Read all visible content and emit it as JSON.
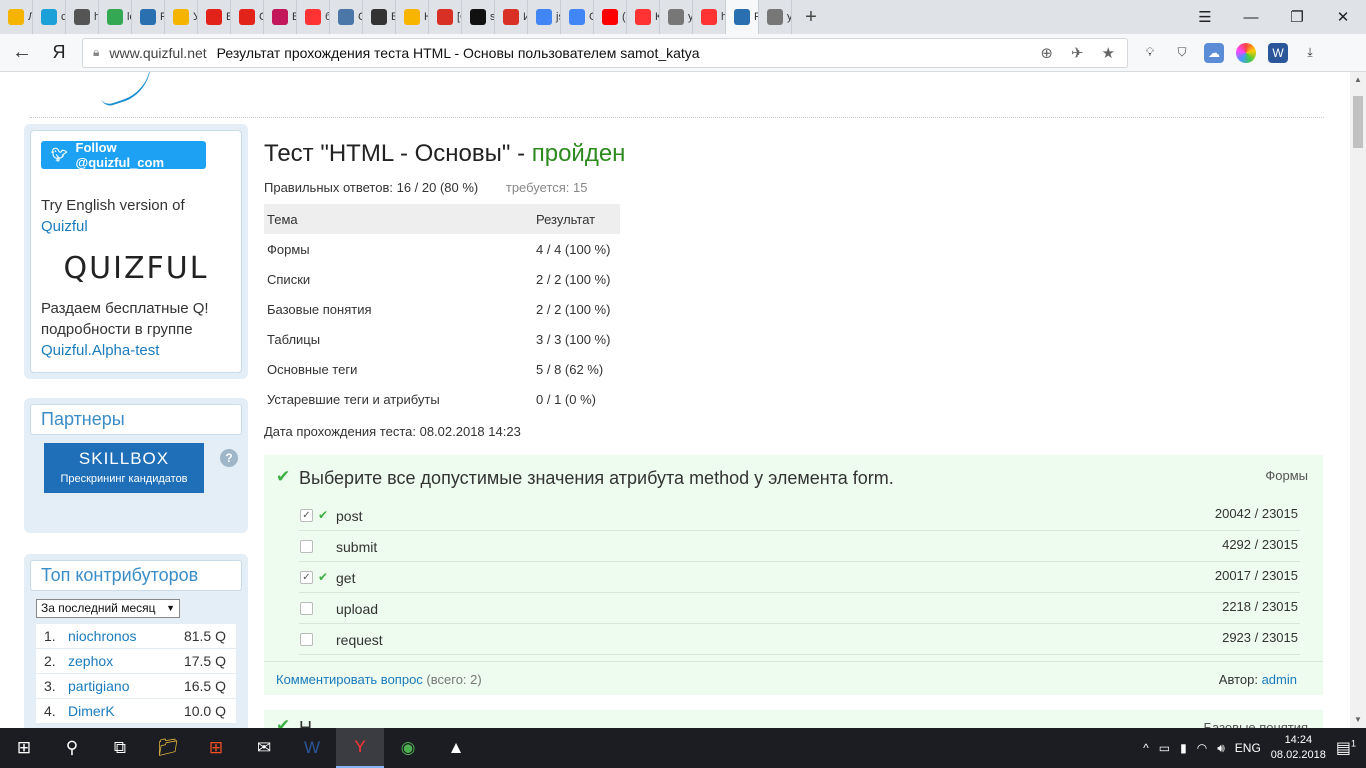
{
  "browser": {
    "tabs": [
      {
        "label": "Л",
        "icon": "lightbulb-icon",
        "color": "#f5b400"
      },
      {
        "label": "cisco",
        "icon": "cisco-icon",
        "color": "#1ba0d7"
      },
      {
        "label": "h",
        "icon": "shield-icon",
        "color": "#555555"
      },
      {
        "label": "le",
        "icon": "drive-icon",
        "color": "#34a853"
      },
      {
        "label": "Р",
        "icon": "quizful-icon",
        "color": "#2a6fb0"
      },
      {
        "label": "У",
        "icon": "lightbulb-icon",
        "color": "#f5b400"
      },
      {
        "label": "В",
        "icon": "figure-icon",
        "color": "#e2231a"
      },
      {
        "label": "С",
        "icon": "figure-icon",
        "color": "#e2231a"
      },
      {
        "label": "В",
        "icon": "video-icon",
        "color": "#c2185b"
      },
      {
        "label": "б",
        "icon": "yandex-icon",
        "color": "#ff3333"
      },
      {
        "label": "С",
        "icon": "doc-icon",
        "color": "#4a76a8"
      },
      {
        "label": "Б",
        "icon": "clapper-icon",
        "color": "#333333"
      },
      {
        "label": "Н",
        "icon": "ph-icon",
        "color": "#f7b500"
      },
      {
        "label": "[С",
        "icon": "gmail-icon",
        "color": "#d93025"
      },
      {
        "label": "s",
        "icon": "github-icon",
        "color": "#111111"
      },
      {
        "label": "И",
        "icon": "gmail-icon",
        "color": "#d93025"
      },
      {
        "label": "js",
        "icon": "docs-icon",
        "color": "#4285f4"
      },
      {
        "label": "G",
        "icon": "translate-icon",
        "color": "#4285f4"
      },
      {
        "label": "(4",
        "icon": "youtube-icon",
        "color": "#ff0000"
      },
      {
        "label": "К",
        "icon": "yandex-icon",
        "color": "#ff3333"
      },
      {
        "label": "у",
        "icon": "page-icon",
        "color": "#777777"
      },
      {
        "label": "h",
        "icon": "yandex-icon",
        "color": "#ff3333"
      },
      {
        "label": "Р",
        "icon": "quizful-icon",
        "color": "#2a6fb0",
        "active": true
      },
      {
        "label": "у",
        "icon": "page-icon",
        "color": "#777777"
      }
    ],
    "url_domain": "www.quizful.net",
    "url_title": "Результат прохождения теста HTML - Основы пользователем samot_katya",
    "yandex_logo": "Я"
  },
  "sidebar": {
    "twitter_label": "Follow @quizful_com",
    "english_text": "Try English version of",
    "english_link": "Quizful",
    "logo_text": "QUIZFUL",
    "promo_line1": "Раздаем бесплатные Q!",
    "promo_line2": "подробности в группе",
    "promo_link": "Quizful.Alpha-test",
    "partners_title": "Партнеры",
    "skillbox_name": "SKILLBOX",
    "skillbox_tagline": "Прескрининг кандидатов",
    "help_glyph": "?",
    "contrib_title": "Топ контрибуторов",
    "period_selected": "За последний месяц",
    "contributors": [
      {
        "rank": "1.",
        "name": "niochronos",
        "score": "81.5 Q"
      },
      {
        "rank": "2.",
        "name": "zephox",
        "score": "17.5 Q"
      },
      {
        "rank": "3.",
        "name": "partigiano",
        "score": "16.5 Q"
      },
      {
        "rank": "4.",
        "name": "DimerK",
        "score": "10.0 Q"
      }
    ]
  },
  "result": {
    "title_prefix": "Тест \"HTML - Основы\" - ",
    "title_status": "пройден",
    "correct_label": "Правильных ответов: 16 / 20 (80 %)",
    "required_label": "требуется: 15",
    "table_headers": [
      "Тема",
      "Результат"
    ],
    "topics": [
      {
        "topic": "Формы",
        "score": "4 / 4 (100 %)"
      },
      {
        "topic": "Списки",
        "score": "2 / 2 (100 %)"
      },
      {
        "topic": "Базовые понятия",
        "score": "2 / 2 (100 %)"
      },
      {
        "topic": "Таблицы",
        "score": "3 / 3 (100 %)"
      },
      {
        "topic": "Основные теги",
        "score": "5 / 8 (62 %)"
      },
      {
        "topic": "Устаревшие теги и атрибуты",
        "score": "0 / 1 (0 %)"
      }
    ],
    "date_label": "Дата прохождения теста: 08.02.2018 14:23"
  },
  "question1": {
    "text": "Выберите все допустимые значения атрибута method у элемента form.",
    "topic": "Формы",
    "answers": [
      {
        "text": "post",
        "count": "20042 / 23015",
        "checked": true,
        "correct": true
      },
      {
        "text": "submit",
        "count": "4292 / 23015",
        "checked": false,
        "correct": false
      },
      {
        "text": "get",
        "count": "20017 / 23015",
        "checked": true,
        "correct": true
      },
      {
        "text": "upload",
        "count": "2218 / 23015",
        "checked": false,
        "correct": false
      },
      {
        "text": "request",
        "count": "2923 / 23015",
        "checked": false,
        "correct": false
      }
    ],
    "comment_link": "Комментировать вопрос",
    "comment_count": "(всего: 2)",
    "author_label": "Автор:",
    "author_name": "admin"
  },
  "question2": {
    "text": "Н",
    "topic": "Базовые понятия"
  },
  "taskbar": {
    "lang": "ENG",
    "time": "14:24",
    "date": "08.02.2018",
    "notifications": "1"
  }
}
